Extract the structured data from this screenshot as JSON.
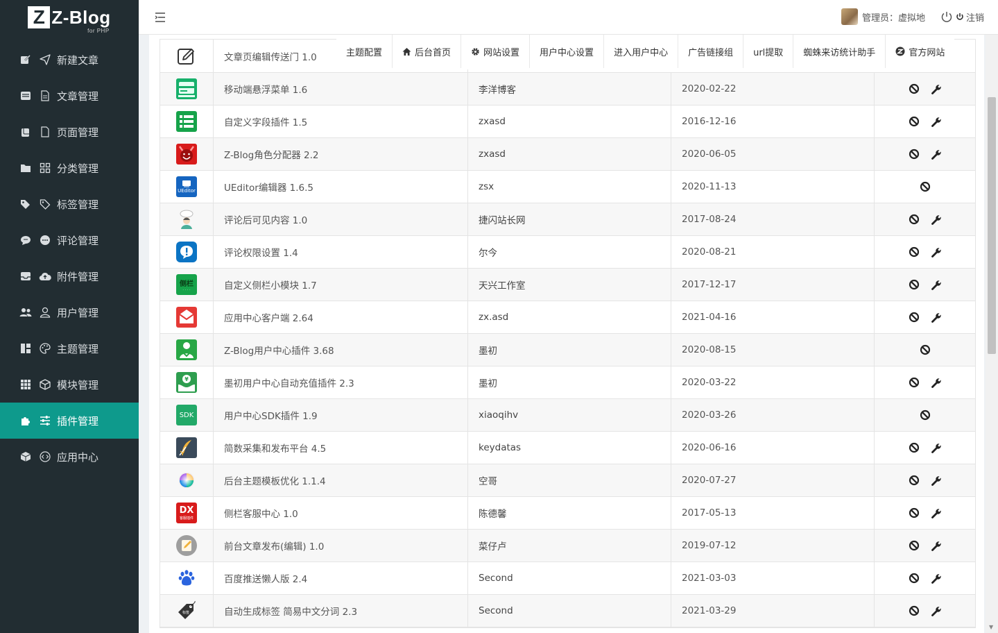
{
  "app": {
    "logo_letter": "Z",
    "logo_text": "Z-Blog",
    "logo_sub": "for PHP"
  },
  "sidebar": {
    "items": [
      {
        "label": "新建文章",
        "icon": "edit-icon",
        "icon2": "send-icon"
      },
      {
        "label": "文章管理",
        "icon": "archive-icon",
        "icon2": "document-icon"
      },
      {
        "label": "页面管理",
        "icon": "copy-icon",
        "icon2": "page-icon"
      },
      {
        "label": "分类管理",
        "icon": "folder-icon",
        "icon2": "grid-icon"
      },
      {
        "label": "标签管理",
        "icon": "tags-icon",
        "icon2": "tag-icon"
      },
      {
        "label": "评论管理",
        "icon": "chat-icon",
        "icon2": "chat-dots-icon"
      },
      {
        "label": "附件管理",
        "icon": "inbox-icon",
        "icon2": "cloud-upload-icon"
      },
      {
        "label": "用户管理",
        "icon": "people-icon",
        "icon2": "person-icon"
      },
      {
        "label": "主题管理",
        "icon": "layout-icon",
        "icon2": "palette-icon"
      },
      {
        "label": "模块管理",
        "icon": "apps-icon",
        "icon2": "box-icon"
      },
      {
        "label": "插件管理",
        "icon": "puzzle-icon",
        "icon2": "sliders-icon",
        "active": true
      },
      {
        "label": "应用中心",
        "icon": "boxes-icon",
        "icon2": "code-icon"
      }
    ]
  },
  "topbar": {
    "admin_label": "管理员：虚拟地",
    "logout_label": "注销"
  },
  "tabs": [
    {
      "label": "主题配置",
      "icon": ""
    },
    {
      "label": "后台首页",
      "icon": "home-icon"
    },
    {
      "label": "网站设置",
      "icon": "gear-icon"
    },
    {
      "label": "用户中心设置",
      "icon": ""
    },
    {
      "label": "进入用户中心",
      "icon": ""
    },
    {
      "label": "广告链接组",
      "icon": ""
    },
    {
      "label": "url提取",
      "icon": ""
    },
    {
      "label": "蜘蛛来访统计助手",
      "icon": ""
    },
    {
      "label": "官方网站",
      "icon": "zblog-icon"
    }
  ],
  "plugins": [
    {
      "name": "文章页编辑传送门 1.0",
      "author": "",
      "date": "",
      "icon": "pen-square-icon",
      "color": "#ffffff",
      "wrench": false
    },
    {
      "name": "移动端悬浮菜单 1.6",
      "author": "李洋博客",
      "date": "2020-02-22",
      "icon": "mobile-menu-icon",
      "color": "#17b06b",
      "wrench": true
    },
    {
      "name": "自定义字段插件 1.5",
      "author": "zxasd",
      "date": "2016-12-16",
      "icon": "list-icon",
      "color": "#16a34a",
      "wrench": true
    },
    {
      "name": "Z-Blog角色分配器 2.2",
      "author": "zxasd",
      "date": "2020-06-05",
      "icon": "devil-icon",
      "color": "#d81b1b",
      "wrench": true
    },
    {
      "name": "UEditor编辑器 1.6.5",
      "author": "zsx",
      "date": "2020-11-13",
      "icon": "ueditor-icon",
      "color": "#1565c0",
      "wrench": false,
      "tag": "UEditor"
    },
    {
      "name": "评论后可见内容 1.0",
      "author": "捷闪站长网",
      "date": "2017-08-24",
      "icon": "person-bubble-icon",
      "color": "#ffffff",
      "wrench": true
    },
    {
      "name": "评论权限设置 1.4",
      "author": "尔今",
      "date": "2020-08-21",
      "icon": "comment-alert-icon",
      "color": "#0b74c4",
      "wrench": true
    },
    {
      "name": "自定义侧栏小模块 1.7",
      "author": "天兴工作室",
      "date": "2017-12-17",
      "icon": "sidebar-text-icon",
      "color": "#16a34a",
      "wrench": true,
      "tag": "侧栏"
    },
    {
      "name": "应用中心客户端 2.64",
      "author": "zx.asd",
      "date": "2021-04-16",
      "icon": "envelope-icon",
      "color": "#e53935",
      "wrench": true
    },
    {
      "name": "Z-Blog用户中心插件 3.68",
      "author": "墨初",
      "date": "2020-08-15",
      "icon": "user-center-icon",
      "color": "#28a745",
      "wrench": false
    },
    {
      "name": "墨初用户中心自动充值插件 2.3",
      "author": "墨初",
      "date": "2020-03-22",
      "icon": "money-hand-icon",
      "color": "#2e9e4f",
      "wrench": true
    },
    {
      "name": "用户中心SDK插件 1.9",
      "author": "xiaoqihv",
      "date": "2020-03-26",
      "icon": "sdk-icon",
      "color": "#22a968",
      "wrench": false,
      "tag": "SDK"
    },
    {
      "name": "简数采集和发布平台 4.5",
      "author": "keydatas",
      "date": "2020-06-16",
      "icon": "quill-icon",
      "color": "#3a4a5a",
      "wrench": true
    },
    {
      "name": "后台主题模板优化 1.1.4",
      "author": "空哥",
      "date": "2020-07-27",
      "icon": "color-wheel-icon",
      "color": "#ffffff",
      "wrench": true
    },
    {
      "name": "侧栏客服中心 1.0",
      "author": "陈德馨",
      "date": "2017-05-13",
      "icon": "dx-icon",
      "color": "#d81b1b",
      "wrench": true,
      "tag": "DX"
    },
    {
      "name": "前台文章发布(编辑) 1.0",
      "author": "菜仔卢",
      "date": "2019-07-12",
      "icon": "edit-circle-icon",
      "color": "#9e9e9e",
      "wrench": true
    },
    {
      "name": "百度推送懒人版 2.4",
      "author": "Second",
      "date": "2021-03-03",
      "icon": "baidu-paw-icon",
      "color": "#ffffff",
      "wrench": true
    },
    {
      "name": "自动生成标签 简易中文分词 2.3",
      "author": "Second",
      "date": "2021-03-29",
      "icon": "price-tag-icon",
      "color": "#ffffff",
      "wrench": true
    }
  ],
  "colors": {
    "sidebar_bg": "#222d32",
    "accent": "#0e9a8c"
  }
}
